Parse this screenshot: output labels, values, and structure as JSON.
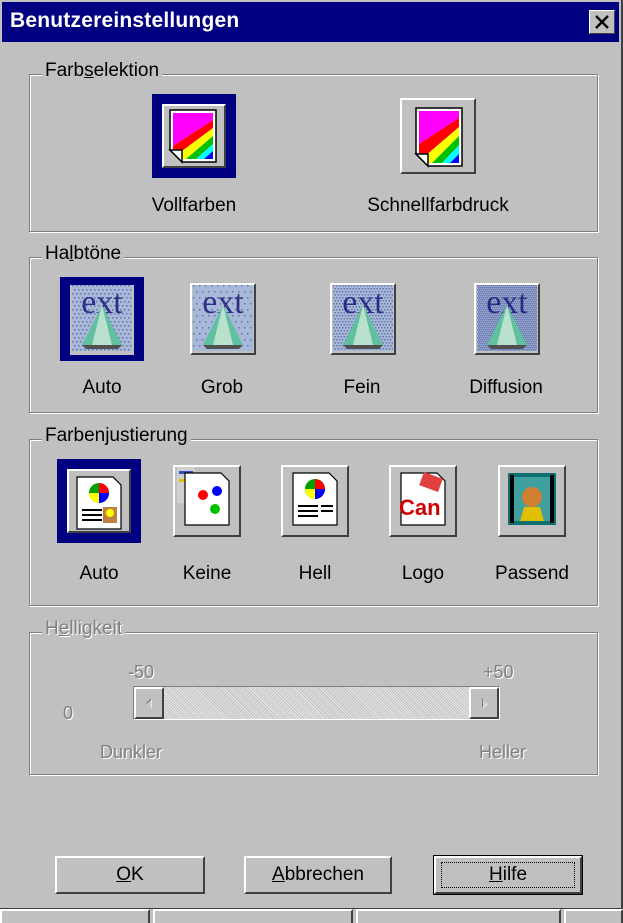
{
  "window": {
    "title": "Benutzereinstellungen",
    "close_symbol": "×"
  },
  "colors": {
    "titlebar": "#000080",
    "face": "#c0c0c0",
    "selected": "#000080",
    "disabled_text": "#808080"
  },
  "farbselektion": {
    "legend": "Farbselektion",
    "options": [
      {
        "label": "Vollfarben",
        "icon": "full-color-icon",
        "selected": true
      },
      {
        "label": "Schnellfarbdruck",
        "icon": "fast-color-icon",
        "selected": false
      }
    ]
  },
  "halbtoene": {
    "legend": "Halbtöne",
    "options": [
      {
        "label": "Auto",
        "icon": "halftone-auto-icon",
        "selected": true
      },
      {
        "label": "Grob",
        "icon": "halftone-coarse-icon",
        "selected": false
      },
      {
        "label": "Fein",
        "icon": "halftone-fine-icon",
        "selected": false
      },
      {
        "label": "Diffusion",
        "icon": "halftone-diffusion-icon",
        "selected": false
      }
    ]
  },
  "farbenjustierung": {
    "legend": "Farbenjustierung",
    "options": [
      {
        "label": "Auto",
        "icon": "color-adjust-auto-icon",
        "selected": true
      },
      {
        "label": "Keine",
        "icon": "color-adjust-none-icon",
        "selected": false
      },
      {
        "label": "Hell",
        "icon": "color-adjust-bright-icon",
        "selected": false
      },
      {
        "label": "Logo",
        "icon": "color-adjust-logo-icon",
        "selected": false
      },
      {
        "label": "Passend",
        "icon": "color-adjust-match-icon",
        "selected": false
      }
    ]
  },
  "helligkeit": {
    "legend": "Helligkeit",
    "enabled": false,
    "min_label": "-50",
    "max_label": "+50",
    "value": "0",
    "value_fraction": 0.0,
    "left_caption": "Dunkler",
    "right_caption": "Heller"
  },
  "buttons": {
    "ok": "OK",
    "cancel": "Abbrechen",
    "help": "Hilfe"
  }
}
